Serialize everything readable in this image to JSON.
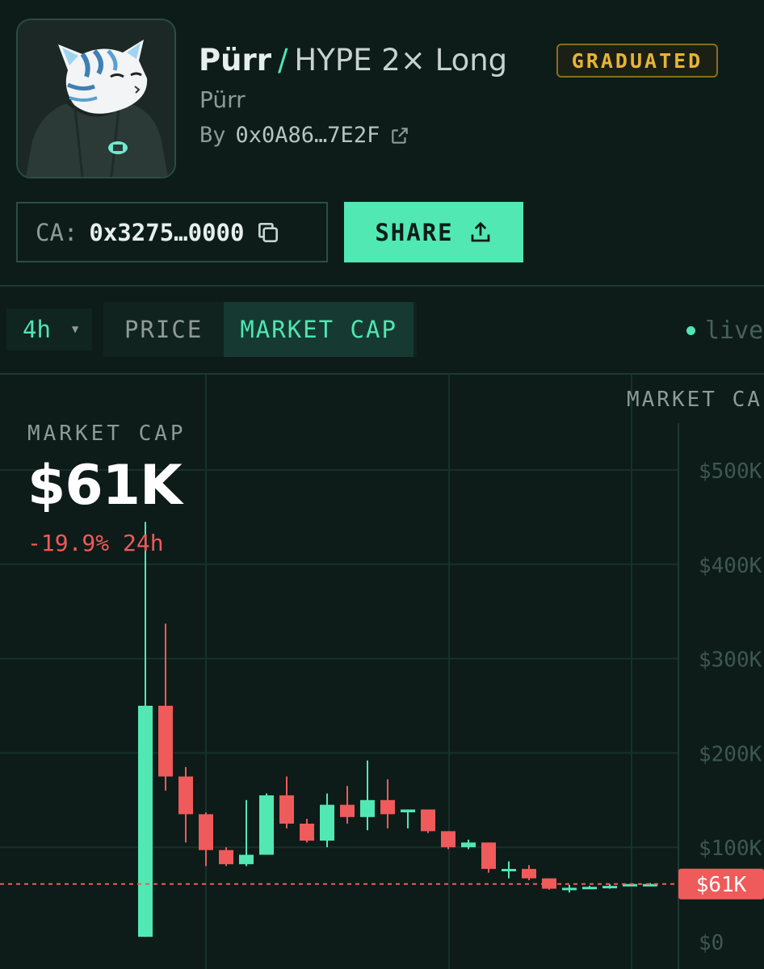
{
  "token": {
    "name": "Pürr",
    "separator": "/",
    "market": "HYPE 2× Long",
    "badge": "GRADUATED",
    "subname": "Pürr",
    "creator_prefix": "By",
    "creator_address": "0x0A86…7E2F",
    "avatar_icon": "cat-in-hoodie-avatar"
  },
  "contract": {
    "label": "CA:",
    "address": "0x3275…0000",
    "copy_icon": "copy-icon"
  },
  "share": {
    "label": "SHARE",
    "icon": "share-upload-icon"
  },
  "toolbar": {
    "interval": "4h",
    "tabs": [
      {
        "label": "PRICE",
        "active": false
      },
      {
        "label": "MARKET CAP",
        "active": true
      }
    ],
    "live": "live"
  },
  "summary": {
    "label": "MARKET CAP",
    "value": "$61K",
    "change": "-19.9% 24h"
  },
  "colors": {
    "up": "#52e8b4",
    "down": "#ef5a5a",
    "badge": "#e8b435",
    "background": "#0d1c19"
  },
  "chart_data": {
    "type": "candlestick",
    "ylabel": "MARKET CAP",
    "ylim": [
      0,
      500000
    ],
    "yticks": [
      0,
      100000,
      200000,
      300000,
      400000,
      500000
    ],
    "ytick_labels": [
      "$0",
      "$100K",
      "$200K",
      "$300K",
      "$400K",
      "$500K"
    ],
    "current_value": 61000,
    "current_label": "$61K",
    "grid": true,
    "candles": [
      {
        "o": 5000,
        "h": 445000,
        "l": 5000,
        "c": 250000
      },
      {
        "o": 250000,
        "h": 337000,
        "l": 160000,
        "c": 175000
      },
      {
        "o": 175000,
        "h": 185000,
        "l": 105000,
        "c": 135000
      },
      {
        "o": 135000,
        "h": 137000,
        "l": 80000,
        "c": 97000
      },
      {
        "o": 97000,
        "h": 100000,
        "l": 80000,
        "c": 82000
      },
      {
        "o": 82000,
        "h": 150000,
        "l": 80000,
        "c": 92000
      },
      {
        "o": 92000,
        "h": 157000,
        "l": 92000,
        "c": 155000
      },
      {
        "o": 155000,
        "h": 175000,
        "l": 120000,
        "c": 125000
      },
      {
        "o": 125000,
        "h": 130000,
        "l": 105000,
        "c": 107000
      },
      {
        "o": 107000,
        "h": 157000,
        "l": 100000,
        "c": 145000
      },
      {
        "o": 145000,
        "h": 165000,
        "l": 125000,
        "c": 132000
      },
      {
        "o": 132000,
        "h": 192000,
        "l": 118000,
        "c": 150000
      },
      {
        "o": 150000,
        "h": 172000,
        "l": 120000,
        "c": 135000
      },
      {
        "o": 137000,
        "h": 140000,
        "l": 120000,
        "c": 140000
      },
      {
        "o": 140000,
        "h": 140000,
        "l": 115000,
        "c": 117000
      },
      {
        "o": 117000,
        "h": 117000,
        "l": 98000,
        "c": 100000
      },
      {
        "o": 100000,
        "h": 108000,
        "l": 98000,
        "c": 105000
      },
      {
        "o": 105000,
        "h": 105000,
        "l": 73000,
        "c": 77000
      },
      {
        "o": 75000,
        "h": 85000,
        "l": 67000,
        "c": 77000
      },
      {
        "o": 77000,
        "h": 81000,
        "l": 65000,
        "c": 67000
      },
      {
        "o": 67000,
        "h": 67000,
        "l": 55000,
        "c": 56000
      },
      {
        "o": 57000,
        "h": 60000,
        "l": 52000,
        "c": 57000
      },
      {
        "o": 57000,
        "h": 59000,
        "l": 56000,
        "c": 58000
      },
      {
        "o": 58000,
        "h": 61000,
        "l": 56000,
        "c": 59000
      },
      {
        "o": 59000,
        "h": 61000,
        "l": 59000,
        "c": 61000
      },
      {
        "o": 61000,
        "h": 62000,
        "l": 60000,
        "c": 61000
      }
    ]
  }
}
